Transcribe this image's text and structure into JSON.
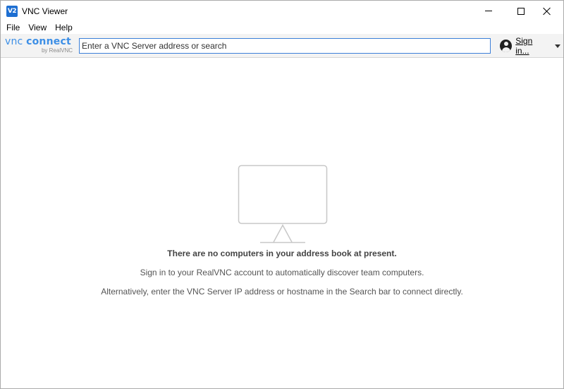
{
  "window": {
    "title": "VNC Viewer",
    "app_icon_text": "V2"
  },
  "menu": {
    "items": [
      "File",
      "View",
      "Help"
    ]
  },
  "toolbar": {
    "logo_main_light": "vnc ",
    "logo_main_bold": "connect",
    "logo_sub": "by RealVNC",
    "search_placeholder": "Enter a VNC Server address or search",
    "sign_in_label": "Sign in..."
  },
  "empty_state": {
    "heading": "There are no computers in your address book at present.",
    "line1": "Sign in to your RealVNC account to automatically discover team computers.",
    "line2": "Alternatively, enter the VNC Server IP address or hostname in the Search bar to connect directly."
  },
  "colors": {
    "accent": "#3c7fd8",
    "logo_blue": "#3d8fe6",
    "toolbar_bg": "#f3f3f3",
    "monitor_stroke": "#c8c8c8"
  },
  "icons": {
    "app": "vnc-viewer-app-icon",
    "minimize": "minimize-icon",
    "maximize": "maximize-icon",
    "close": "close-icon",
    "account": "user-avatar-icon",
    "dropdown": "chevron-down-icon",
    "empty": "monitor-icon"
  }
}
